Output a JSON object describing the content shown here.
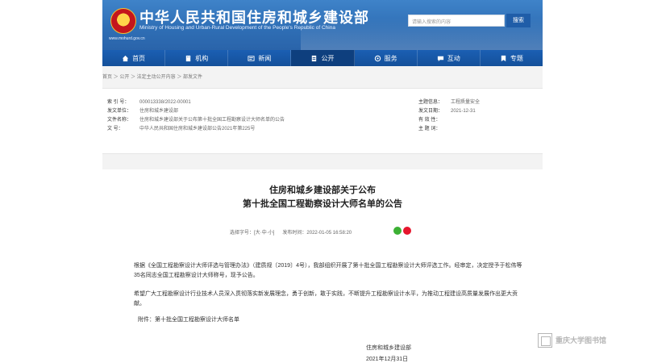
{
  "header": {
    "title": "中华人民共和国住房和城乡建设部",
    "subtitle": "Ministry of Housing and Urban-Rural Development of the People's Republic of China",
    "domain": "www.mohurd.gov.cn",
    "search_placeholder": "请输入搜索的内容",
    "search_button": "搜索"
  },
  "nav": {
    "items": [
      {
        "label": "首页",
        "icon": "home-icon"
      },
      {
        "label": "机构",
        "icon": "building-icon"
      },
      {
        "label": "新闻",
        "icon": "news-icon"
      },
      {
        "label": "公开",
        "icon": "document-icon"
      },
      {
        "label": "服务",
        "icon": "service-icon"
      },
      {
        "label": "互动",
        "icon": "chat-icon"
      },
      {
        "label": "专题",
        "icon": "topic-icon"
      }
    ]
  },
  "breadcrumb": "首页 ＞ 公开 ＞ 法定主动公开内容 ＞ 部发文件",
  "meta": {
    "index_label": "索 引 号：",
    "index_value": "000013338/2022-00001",
    "issuer_label": "发文单位：",
    "issuer_value": "住房和城乡建设部",
    "name_label": "文件名称：",
    "name_value": "住房和城乡建设部关于公布第十批全国工程勘察设计大师名单的公告",
    "number_label": "文    号：",
    "number_value": "中华人民共和国住房和城乡建设部公告2021年第225号",
    "category_label": "主题信息：",
    "category_value": "工程质量安全",
    "date_label": "发文日期：",
    "date_value": "2021-12-31",
    "valid_label": "有 效 性：",
    "valid_value": "",
    "keyword_label": "主 题 词：",
    "keyword_value": ""
  },
  "article": {
    "title1": "住房和城乡建设部关于公布",
    "title2": "第十批全国工程勘察设计大师名单的公告",
    "font_size_prefix": "选择字号：[",
    "font_size_large": "大",
    "font_size_medium": "中",
    "font_size_small": "小",
    "font_size_suffix": "]",
    "publish_time": "发布时间：2022-01-05 16:58:20",
    "para1": "根据《全国工程勘察设计大师评选与管理办法》（建质规〔2019〕4号），我部组织开展了第十批全国工程勘察设计大师评选工作。经审定，决定授予于松伟等35名同志全国工程勘察设计大师称号，现予公告。",
    "para2": "希望广大工程勘察设计行业技术人员深入贯彻落实新发展理念，勇于创新，敢于实践，不断提升工程勘察设计水平，为推动工程建设高质量发展作出更大贡献。",
    "attachment": "附件：第十批全国工程勘察设计大师名单",
    "sign_org": "住房和城乡建设部",
    "sign_date": "2021年12月31日"
  },
  "watermark": "重庆大学图书馆",
  "colors": {
    "header_blue": "#2f6fb6",
    "nav_blue": "#1b5fb3",
    "nav_active": "#0e3f7e",
    "emblem_red": "#c4161c",
    "emblem_gold": "#ffd54a",
    "text": "#333333"
  }
}
